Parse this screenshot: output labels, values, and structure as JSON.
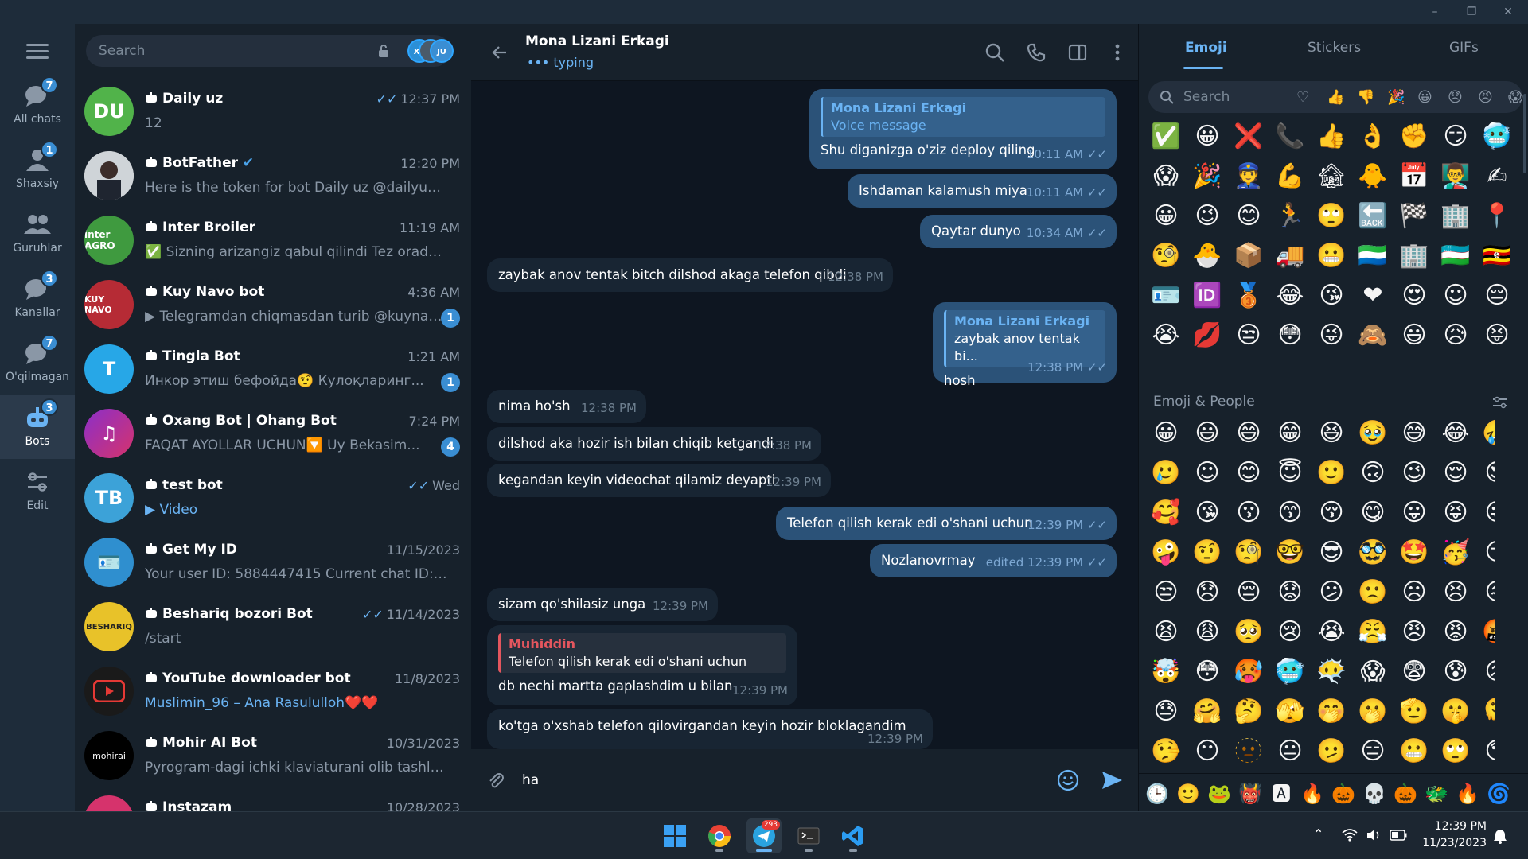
{
  "window": {
    "controls": [
      "–",
      "❐",
      "✕"
    ]
  },
  "rail": {
    "folders": [
      {
        "label": "All chats",
        "badge": "7"
      },
      {
        "label": "Shaxsiy",
        "badge": "1"
      },
      {
        "label": "Guruhlar",
        "badge": ""
      },
      {
        "label": "Kanallar",
        "badge": "3"
      },
      {
        "label": "O'qilmagan",
        "badge": "7"
      },
      {
        "label": "Bots",
        "badge": "3"
      },
      {
        "label": "Edit",
        "badge": ""
      }
    ]
  },
  "chatlist": {
    "search_placeholder": "Search",
    "accounts": [
      "X8",
      "",
      "JU"
    ],
    "chats": [
      {
        "initials": "DU",
        "name": "Daily uz",
        "time": "12:37 PM",
        "preview": "12",
        "badge": "",
        "ticks": "✓✓"
      },
      {
        "initials": "",
        "name": "BotFather",
        "time": "12:20 PM",
        "preview": "Here is the token for bot Daily uz @dailyuzbbot...",
        "badge": "",
        "ticks": ""
      },
      {
        "initials": "",
        "name": "Inter Broiler",
        "time": "11:19 AM",
        "preview": "✅ Sizning arizangiz qabul qilindi Tez orada admi...",
        "badge": "",
        "ticks": ""
      },
      {
        "initials": "",
        "name": "Kuy Navo bot",
        "time": "4:36 AM",
        "preview": "Telegramdan chiqmasdan turib @kuynav...",
        "badge": "1",
        "ticks": ""
      },
      {
        "initials": "T",
        "name": "Tingla Bot",
        "time": "1:21 AM",
        "preview": "Инкор этиш бефойда🤨 Кулоқларинг...",
        "badge": "1",
        "ticks": ""
      },
      {
        "initials": "",
        "name": "Oxang Bot | Ohang Bot",
        "time": "7:24 PM",
        "preview": "FAQAT AYOLLAR UCHUN🔽 Uy Bekasim...",
        "badge": "4",
        "ticks": ""
      },
      {
        "initials": "TB",
        "name": "test bot",
        "time": "Wed",
        "preview": "Video",
        "badge": "",
        "ticks": "✓✓"
      },
      {
        "initials": "",
        "name": "Get My ID",
        "time": "11/15/2023",
        "preview": "Your user ID: 5884447415 Current chat ID: 5884...",
        "badge": "",
        "ticks": ""
      },
      {
        "initials": "",
        "name": "Beshariq bozori Bot",
        "time": "11/14/2023",
        "preview": "/start",
        "badge": "",
        "ticks": "✓✓"
      },
      {
        "initials": "",
        "name": "YouTube downloader bot",
        "time": "11/8/2023",
        "preview": "Muslimin_96 – Ana Rasululloh❤️❤️",
        "badge": "",
        "ticks": ""
      },
      {
        "initials": "mohirai",
        "name": "Mohir AI Bot",
        "time": "10/31/2023",
        "preview": "Pyrogram-dagi ichki klaviaturani olib tashlash uch...",
        "badge": "",
        "ticks": ""
      },
      {
        "initials": "",
        "name": "Instazam",
        "time": "10/28/2023",
        "preview": "",
        "badge": "",
        "ticks": ""
      }
    ]
  },
  "conversation": {
    "peer_name": "Mona Lizani Erkagi",
    "peer_status": "typing",
    "messages": [
      {
        "dir": "out",
        "reply_name": "Mona Lizani Erkagi",
        "reply_text": "Voice message",
        "text": "Shu diganizga o'ziz deploy qiling",
        "time": "10:11 AM"
      },
      {
        "dir": "out",
        "text": "Ishdaman kalamush miya",
        "time": "10:11 AM"
      },
      {
        "dir": "out",
        "text": "Qaytar dunyo",
        "time": "10:34 AM"
      },
      {
        "dir": "in",
        "text": "zaybak anov tentak bitch dilshod akaga telefon qibdi",
        "time": "12:38 PM"
      },
      {
        "dir": "out",
        "reply_name": "Mona Lizani Erkagi",
        "reply_text": "zaybak anov tentak bi...",
        "text": "hosh",
        "time": "12:38 PM"
      },
      {
        "dir": "in",
        "text": "nima ho'sh",
        "time": "12:38 PM"
      },
      {
        "dir": "in",
        "text": "dilshod aka hozir ish bilan chiqib ketgandi",
        "time": "12:38 PM"
      },
      {
        "dir": "in",
        "text": "kegandan keyin videochat qilamiz deyapti",
        "time": "12:39 PM"
      },
      {
        "dir": "out",
        "text": "Telefon qilish kerak edi o'shani uchun",
        "time": "12:39 PM"
      },
      {
        "dir": "out",
        "text": "Nozlanovrmay",
        "time": "edited 12:39 PM"
      },
      {
        "dir": "in",
        "text": "sizam qo'shilasiz unga",
        "time": "12:39 PM"
      },
      {
        "dir": "in",
        "reply_name": "Muhiddin",
        "reply_text": "Telefon qilish kerak edi o'shani uchun",
        "text": "db nechi martta gaplashdim u bilan",
        "time": "12:39 PM"
      },
      {
        "dir": "in",
        "text": "ko'tga o'xshab telefon qilovirgandan keyin hozir bloklagandim",
        "time": "12:39 PM"
      }
    ],
    "composer_value": "ha"
  },
  "emoji_panel": {
    "tabs": [
      "Emoji",
      "Stickers",
      "GIFs"
    ],
    "search_placeholder": "Search",
    "categories": [
      "♡",
      "👍",
      "👎",
      "🎉",
      "😀",
      "😞",
      "😠",
      "😱"
    ],
    "recent": [
      "✅",
      "😀",
      "❌",
      "📞",
      "👍",
      "👌",
      "✊",
      "😏",
      "🥶",
      "😱",
      "🎉",
      "👮",
      "💪",
      "🏚",
      "🐥",
      "📅",
      "👨‍🏫",
      "✍",
      "😀",
      "😉",
      "😊",
      "🏃",
      "🙄",
      "🔙",
      "🏁",
      "🏢",
      "📍",
      "🧐",
      "🐣",
      "📦",
      "🚚",
      "😬",
      "🇸🇱",
      "🏢",
      "🇺🇿",
      "🇺🇬",
      "🪪",
      "🆔",
      "🥉",
      "😂",
      "😘",
      "❤",
      "😍",
      "☺",
      "😔",
      "😭",
      "💋",
      "😒",
      "😳",
      "😜",
      "🙈",
      "😃",
      "😥",
      "😝"
    ],
    "section_title": "Emoji & People",
    "people": [
      "😀",
      "😃",
      "😄",
      "😁",
      "😆",
      "🥹",
      "😅",
      "😂",
      "🤣",
      "🥲",
      "☺",
      "😊",
      "😇",
      "🙂",
      "🙃",
      "😉",
      "😌",
      "😍",
      "🥰",
      "😘",
      "😗",
      "😙",
      "😚",
      "😋",
      "😛",
      "😝",
      "😜",
      "🤪",
      "🤨",
      "🧐",
      "🤓",
      "😎",
      "🥸",
      "🤩",
      "🥳",
      "😏",
      "😒",
      "😞",
      "😔",
      "😟",
      "😕",
      "🙁",
      "☹",
      "😣",
      "😖",
      "😫",
      "😩",
      "🥺",
      "😢",
      "😭",
      "😤",
      "😠",
      "😡",
      "🤬",
      "🤯",
      "😳",
      "🥵",
      "🥶",
      "😶‍🌫️",
      "😱",
      "😨",
      "😰",
      "😥",
      "😓",
      "🤗",
      "🤔",
      "🫣",
      "🤭",
      "🫢",
      "🫡",
      "🤫",
      "🫠",
      "🤥",
      "😶",
      "🫥",
      "😐",
      "🫤",
      "😑",
      "😬",
      "🙄",
      "😯",
      "😦",
      "😧",
      "😮",
      "😲",
      "🥱",
      "😴",
      "🤤",
      "😪"
    ],
    "packs": [
      "🕒",
      "🙂",
      "🐸",
      "👹",
      "🅰",
      "🔥",
      "🎃",
      "💀",
      "🎃",
      "🐲",
      "🔥",
      "🌀"
    ]
  },
  "taskbar": {
    "clock_time": "12:39 PM",
    "clock_date": "11/23/2023",
    "telegram_badge": "293"
  }
}
